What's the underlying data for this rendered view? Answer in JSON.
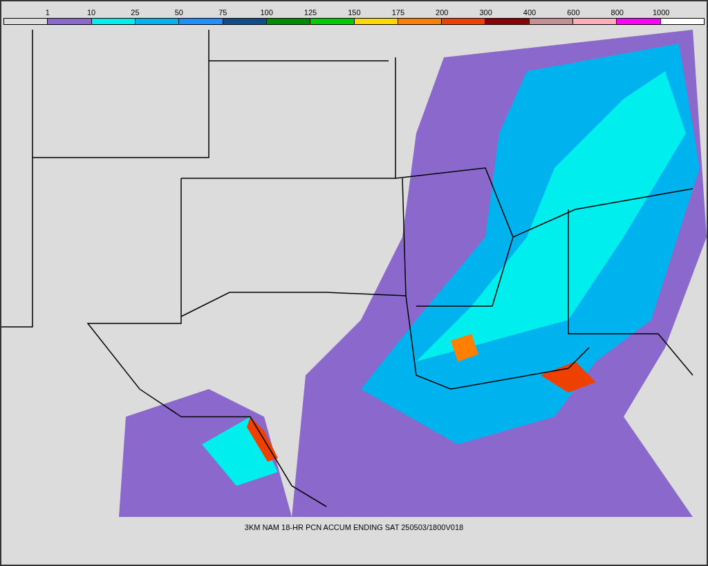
{
  "legend": {
    "labels": [
      "1",
      "10",
      "25",
      "50",
      "75",
      "100",
      "125",
      "150",
      "175",
      "200",
      "300",
      "400",
      "600",
      "800",
      "1000"
    ],
    "swatches": [
      {
        "color": "#dcdcdc"
      },
      {
        "color": "#8b68cc"
      },
      {
        "color": "#00eeee"
      },
      {
        "color": "#00b2ee"
      },
      {
        "color": "#1e90ff"
      },
      {
        "color": "#104e8b"
      },
      {
        "color": "#008b00"
      },
      {
        "color": "#00cd00"
      },
      {
        "color": "#ffd700"
      },
      {
        "color": "#ff7f00"
      },
      {
        "color": "#ee4000"
      },
      {
        "color": "#8b0000"
      },
      {
        "color": "#c48e96"
      },
      {
        "color": "#ffaeb9"
      },
      {
        "color": "#ff00ff"
      },
      {
        "color": "#ffffff"
      }
    ]
  },
  "caption": "3KM NAM 18-HR PCN ACCUM ENDING SAT 250503/1800V018"
}
